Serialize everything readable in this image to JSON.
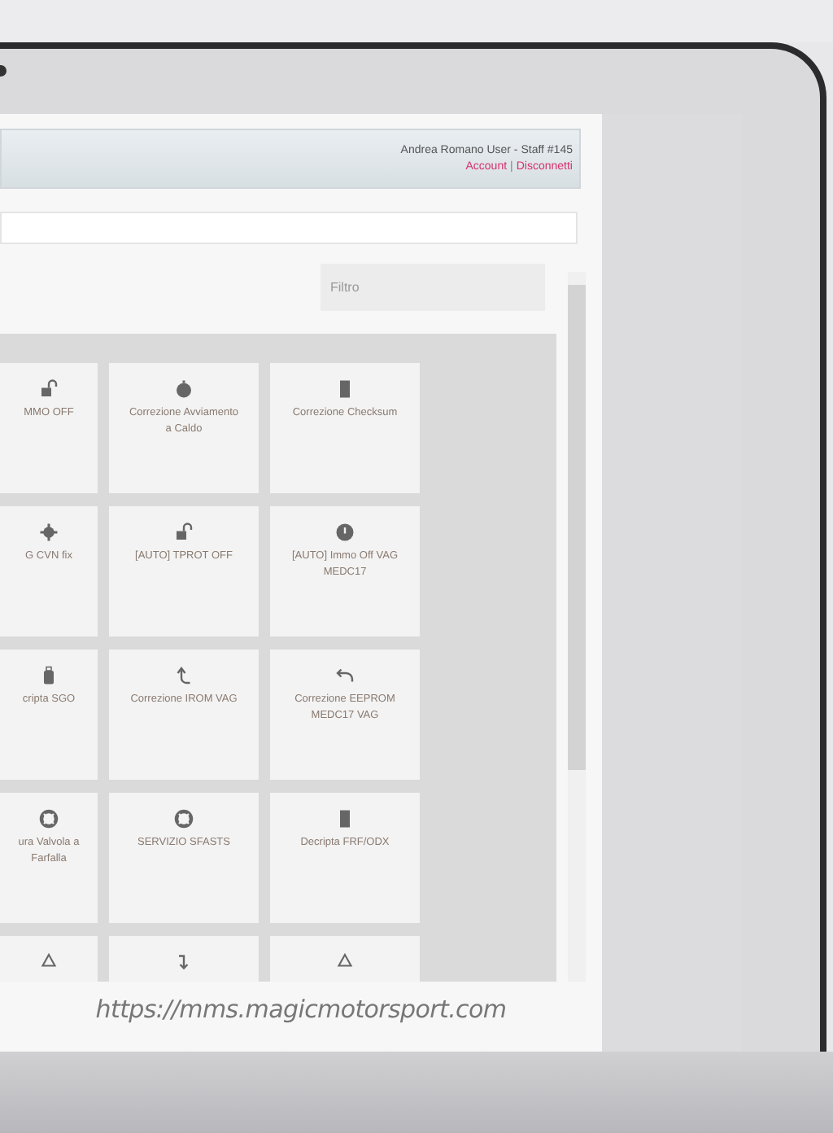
{
  "header": {
    "user": "Andrea Romano User - Staff #145",
    "links": [
      {
        "label": "Account"
      },
      {
        "label": "Disconnetti"
      }
    ],
    "separator": "|"
  },
  "filter": {
    "placeholder": "Filtro"
  },
  "tiles": [
    {
      "kind": "lock",
      "label": "MMO OFF"
    },
    {
      "kind": "gauge",
      "label": "Correzione Avviamento a Caldo"
    },
    {
      "kind": "document",
      "label": "Correzione Checksum"
    },
    {
      "kind": "cog",
      "label": "G CVN fix"
    },
    {
      "kind": "lock",
      "label": "[AUTO] TPROT OFF"
    },
    {
      "kind": "alert",
      "label": "[AUTO] Immo Off VAG MEDC17"
    },
    {
      "kind": "bag",
      "label": "cripta SGO"
    },
    {
      "kind": "turn",
      "label": "Correzione IROM VAG"
    },
    {
      "kind": "undo",
      "label": "Correzione EEPROM MEDC17 VAG"
    },
    {
      "kind": "lifebuoy",
      "label": "ura Valvola a Farfalla"
    },
    {
      "kind": "lifebuoy",
      "label": "SERVIZIO SFASTS"
    },
    {
      "kind": "document",
      "label": "Decripta FRF/ODX"
    },
    {
      "kind": "recycle"
    },
    {
      "kind": "down"
    },
    {
      "kind": "recycle"
    }
  ],
  "url": "https://mms.magicmotorsport.com"
}
